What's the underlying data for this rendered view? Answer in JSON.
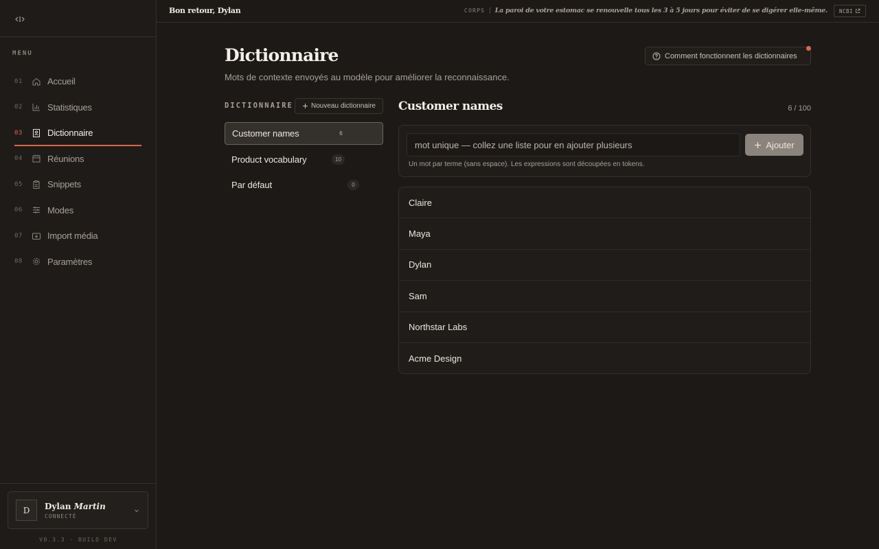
{
  "sidebar": {
    "menu_title": "MENU",
    "items": [
      {
        "num": "01",
        "label": "Accueil",
        "icon": "home-icon"
      },
      {
        "num": "02",
        "label": "Statistiques",
        "icon": "bar-chart-icon"
      },
      {
        "num": "03",
        "label": "Dictionnaire",
        "icon": "book-icon"
      },
      {
        "num": "04",
        "label": "Réunions",
        "icon": "calendar-icon"
      },
      {
        "num": "05",
        "label": "Snippets",
        "icon": "clipboard-icon"
      },
      {
        "num": "06",
        "label": "Modes",
        "icon": "sliders-icon"
      },
      {
        "num": "07",
        "label": "Import média",
        "icon": "media-import-icon"
      },
      {
        "num": "08",
        "label": "Paramètres",
        "icon": "gear-icon"
      }
    ],
    "user": {
      "initial": "D",
      "first_name": "Dylan",
      "last_name": "Martin",
      "status": "CONNECTÉ"
    },
    "version": "V0.3.3 · BUILD DEV"
  },
  "topbar": {
    "welcome": "Bon retour, Dylan",
    "fact_tag": "CORPS",
    "fact_sep": "|",
    "fact_text": "La paroi de votre estomac se renouvelle tous les 3 à 5 jours pour éviter de se digérer elle-même.",
    "source_label": "NCBI"
  },
  "page": {
    "title": "Dictionnaire",
    "subtitle": "Mots de contexte envoyés au modèle pour améliorer la reconnaissance.",
    "help_label": "Comment fonctionnent les dictionnaires"
  },
  "dictionaries": {
    "header": "DICTIONNAIRE",
    "new_label": "Nouveau dictionnaire",
    "items": [
      {
        "name": "Customer names",
        "count": "6"
      },
      {
        "name": "Product vocabulary",
        "count": "10"
      },
      {
        "name": "Par défaut",
        "count": "0"
      }
    ]
  },
  "detail": {
    "title": "Customer names",
    "count": "6 / 100",
    "input_placeholder": "mot unique — collez une liste pour en ajouter plusieurs",
    "add_label": "Ajouter",
    "hint": "Un mot par terme (sans espace). Les expressions sont découpées en tokens.",
    "words": [
      "Claire",
      "Maya",
      "Dylan",
      "Sam",
      "Northstar Labs",
      "Acme Design"
    ]
  },
  "colors": {
    "background": "#1c1917",
    "accent": "#e0664a",
    "add_button": "#8a847d"
  }
}
